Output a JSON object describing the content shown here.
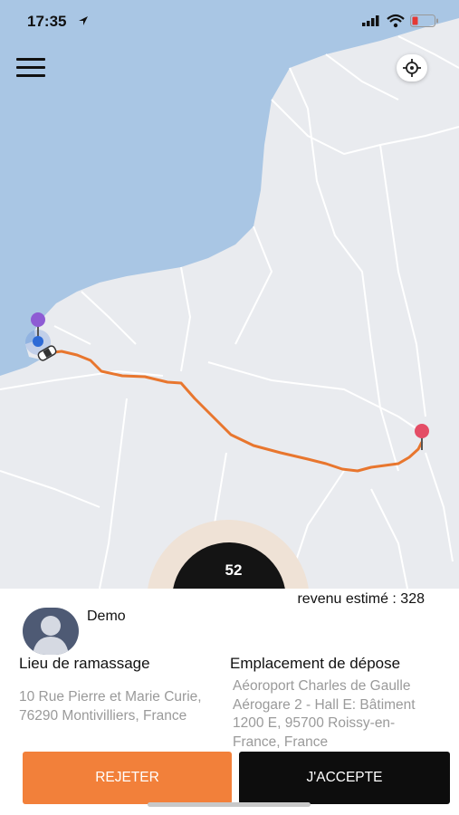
{
  "status_bar": {
    "time": "17:35"
  },
  "map": {
    "colors": {
      "sea": "#a9c6e4",
      "land": "#e9ebef",
      "route": "#e8762e"
    }
  },
  "request": {
    "timer": "52",
    "estimated_revenue": "revenu estimé : 328",
    "passenger_name": "Demo",
    "pickup_title": "Lieu de ramassage",
    "pickup_address": "10 Rue Pierre et Marie Curie, 76290 Montivilliers, France",
    "dropoff_title": "Emplacement de dépose",
    "dropoff_address": "Aéoroport Charles de Gaulle Aérogare 2 - Hall E: Bâtiment 1200 E, 95700 Roissy-en-France, France",
    "reject_label": "REJETER",
    "accept_label": "J'ACCEPTE"
  },
  "colors": {
    "reject": "#f2803a",
    "accept": "#0d0d0d"
  },
  "icons": [
    "navigation-arrow-icon",
    "signal-icon",
    "wifi-icon",
    "battery-icon",
    "menu-icon",
    "locate-icon",
    "pickup-pin-icon",
    "car-icon",
    "dropoff-pin-icon",
    "avatar-icon"
  ]
}
